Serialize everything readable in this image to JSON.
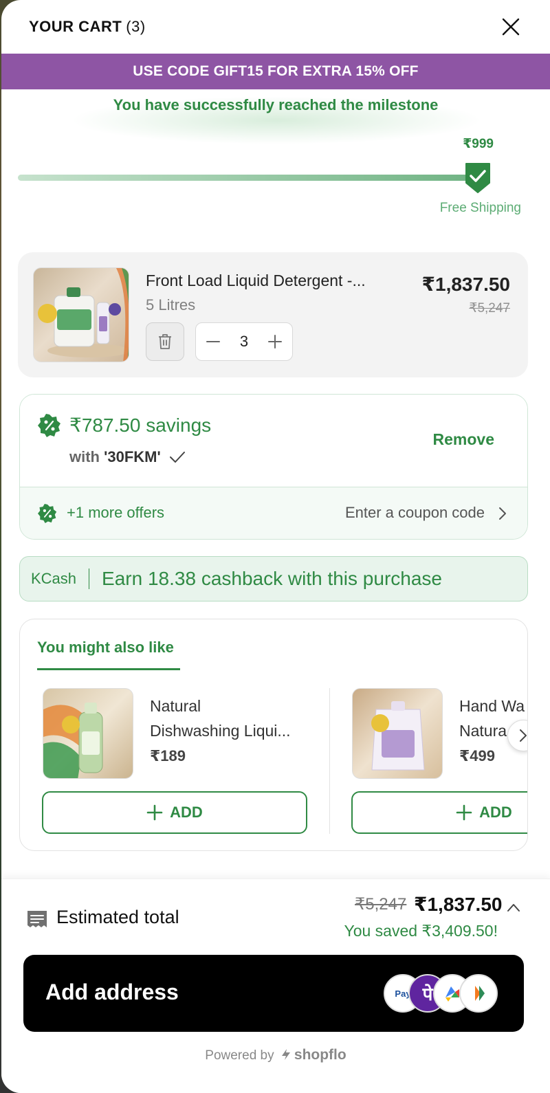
{
  "header": {
    "title": "YOUR CART",
    "count": "(3)"
  },
  "promo": {
    "text": "USE CODE GIFT15 FOR EXTRA 15% OFF",
    "color": "#8e55a4"
  },
  "milestone": {
    "message": "You have successfully reached the milestone",
    "amount": "₹999",
    "label": "Free Shipping",
    "progress": 1.0
  },
  "cart_item": {
    "name": "Front Load Liquid Detergent -...",
    "variant": "5 Litres",
    "price": "₹1,837.50",
    "mrp": "₹5,247",
    "quantity": "3"
  },
  "coupon": {
    "savings": "₹787.50 savings",
    "with_prefix": "with",
    "code": "'30FKM'",
    "remove_label": "Remove",
    "more_offers": "+1 more offers",
    "enter_coupon": "Enter a coupon code"
  },
  "kcash": {
    "label": "KCash",
    "text": "Earn 18.38 cashback with this purchase"
  },
  "recommendations": {
    "title": "You might also like",
    "items": [
      {
        "name_line1": "Natural",
        "name_line2": "Dishwashing Liqui...",
        "price": "₹189",
        "add_label": "ADD"
      },
      {
        "name_line1": "Hand Wa",
        "name_line2": "Natura",
        "price": "₹499",
        "add_label": "ADD"
      }
    ]
  },
  "footer": {
    "label": "Estimated total",
    "mrp": "₹5,247",
    "total": "₹1,837.50",
    "saved": "You saved ₹3,409.50!",
    "cta": "Add address",
    "powered_by": "Powered by",
    "brand": "shopflo"
  },
  "colors": {
    "accent_green": "#2f8a44",
    "promo_purple": "#8e55a4",
    "cta_black": "#000000"
  },
  "icons": [
    "close-icon",
    "check-icon",
    "trash-icon",
    "minus-icon",
    "plus-icon",
    "discount-icon",
    "chevron-right-icon",
    "chevron-up-icon",
    "receipt-icon",
    "paytm-icon",
    "phonepe-icon",
    "gpay-icon",
    "bhim-icon"
  ]
}
